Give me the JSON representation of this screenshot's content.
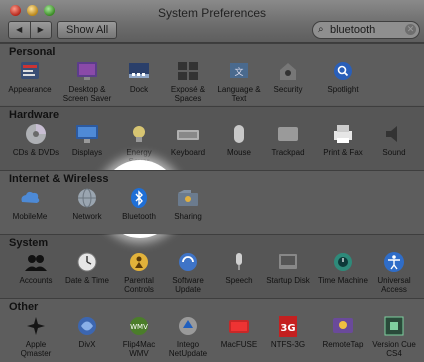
{
  "window": {
    "title": "System Preferences"
  },
  "toolbar": {
    "back_label": "◀",
    "forward_label": "▶",
    "show_all_label": "Show All"
  },
  "search": {
    "value": "bluetooth",
    "search_icon": "⌕",
    "clear_icon": "✕"
  },
  "sections": [
    {
      "title": "Personal",
      "items": [
        {
          "label": "Appearance",
          "icon": "appearance-icon"
        },
        {
          "label": "Desktop &\nScreen Saver",
          "icon": "desktop-icon"
        },
        {
          "label": "Dock",
          "icon": "dock-icon"
        },
        {
          "label": "Exposé &\nSpaces",
          "icon": "expose-icon"
        },
        {
          "label": "Language &\nText",
          "icon": "language-icon"
        },
        {
          "label": "Security",
          "icon": "security-icon"
        },
        {
          "label": "Spotlight",
          "icon": "spotlight-icon"
        }
      ]
    },
    {
      "title": "Hardware",
      "items": [
        {
          "label": "CDs & DVDs",
          "icon": "cd-icon"
        },
        {
          "label": "Displays",
          "icon": "display-icon"
        },
        {
          "label": "Energy\nSaver",
          "icon": "energy-icon"
        },
        {
          "label": "Keyboard",
          "icon": "keyboard-icon"
        },
        {
          "label": "Mouse",
          "icon": "mouse-icon"
        },
        {
          "label": "Trackpad",
          "icon": "trackpad-icon"
        },
        {
          "label": "Print & Fax",
          "icon": "printer-icon"
        },
        {
          "label": "Sound",
          "icon": "sound-icon"
        }
      ]
    },
    {
      "title": "Internet & Wireless",
      "items": [
        {
          "label": "MobileMe",
          "icon": "mobileme-icon"
        },
        {
          "label": "Network",
          "icon": "network-icon"
        },
        {
          "label": "Bluetooth",
          "icon": "bluetooth-icon"
        },
        {
          "label": "Sharing",
          "icon": "sharing-icon"
        }
      ]
    },
    {
      "title": "System",
      "items": [
        {
          "label": "Accounts",
          "icon": "accounts-icon"
        },
        {
          "label": "Date & Time",
          "icon": "clock-icon"
        },
        {
          "label": "Parental\nControls",
          "icon": "parental-icon"
        },
        {
          "label": "Software\nUpdate",
          "icon": "update-icon"
        },
        {
          "label": "Speech",
          "icon": "microphone-icon"
        },
        {
          "label": "Startup Disk",
          "icon": "disk-icon"
        },
        {
          "label": "Time Machine",
          "icon": "timemachine-icon"
        },
        {
          "label": "Universal\nAccess",
          "icon": "accessibility-icon"
        }
      ]
    },
    {
      "title": "Other",
      "items": [
        {
          "label": "Apple\nQmaster",
          "icon": "qmaster-icon"
        },
        {
          "label": "DivX",
          "icon": "divx-icon"
        },
        {
          "label": "Flip4Mac\nWMV",
          "icon": "wmv-icon",
          "badge": "WMV"
        },
        {
          "label": "Intego\nNetUpdate",
          "icon": "intego-icon"
        },
        {
          "label": "MacFUSE",
          "icon": "macfuse-icon"
        },
        {
          "label": "NTFS-3G",
          "icon": "ntfs-icon",
          "badge": "3G"
        },
        {
          "label": "RemoteTap",
          "icon": "remotetap-icon"
        },
        {
          "label": "Version Cue\nCS4",
          "icon": "versioncue-icon"
        }
      ]
    }
  ],
  "colors": {
    "highlight": "#ffffff",
    "bluetooth_blue": "#1f6fd6"
  }
}
